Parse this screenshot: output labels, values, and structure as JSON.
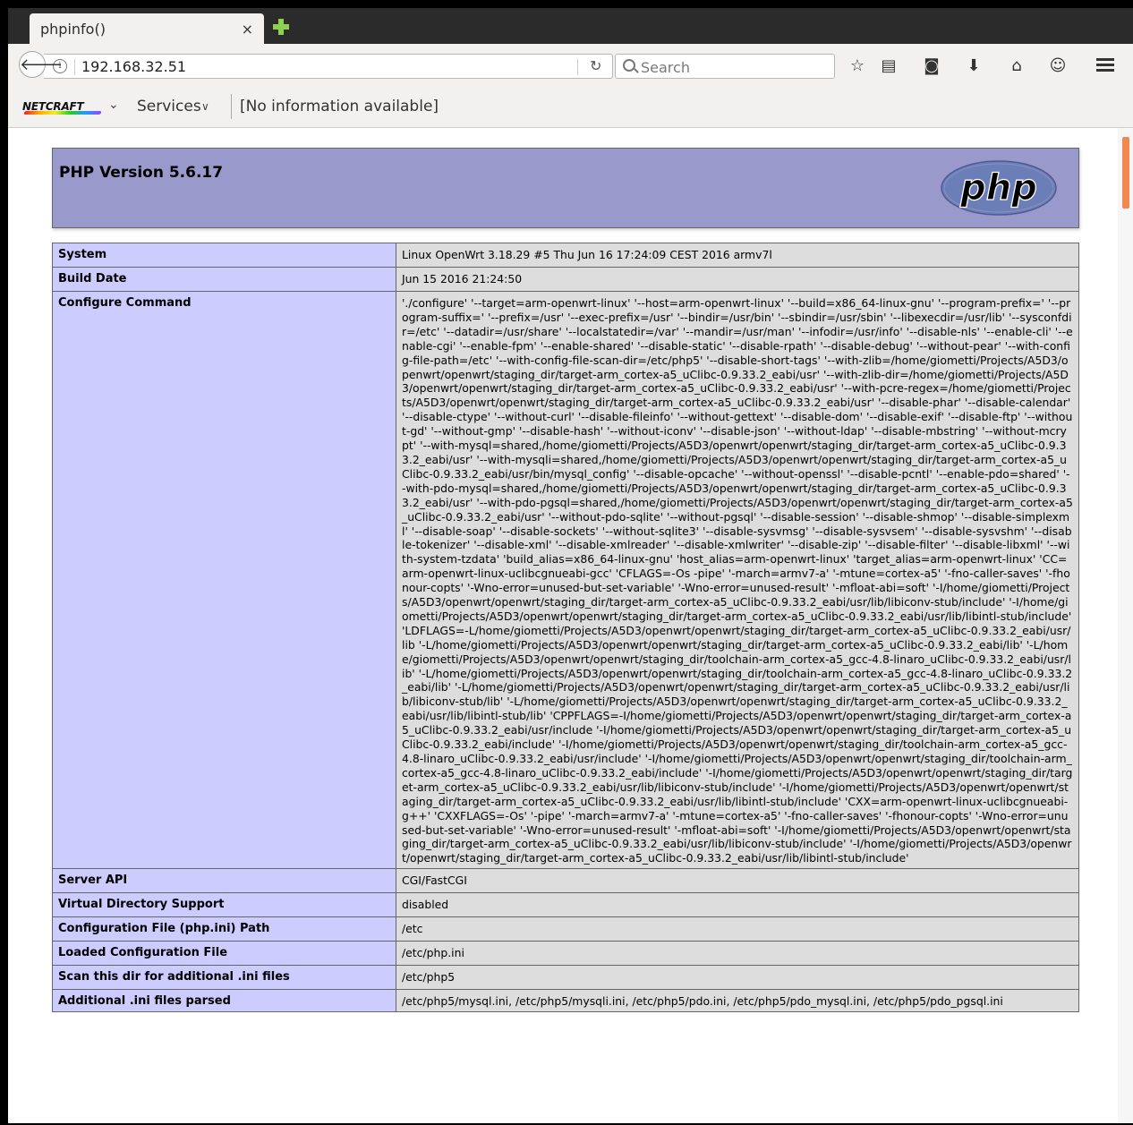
{
  "browser": {
    "tab_title": "phpinfo()",
    "tab_close": "×",
    "url": "192.168.32.51",
    "search_placeholder": "Search",
    "icons": {
      "back": "back-arrow-icon",
      "info": "info-icon",
      "reload": "reload-icon",
      "search": "search-icon",
      "bookmark": "star-icon",
      "reading_list": "clipboard-icon",
      "pocket": "pocket-icon",
      "downloads": "download-icon",
      "home": "home-icon",
      "chat": "chat-icon",
      "menu": "hamburger-menu-icon"
    }
  },
  "netcraft": {
    "logo_text": "NETCRAFT",
    "services_label": "Services",
    "info_text": "[No information available]"
  },
  "colors": {
    "header_bg": "#9999cc",
    "label_bg": "#ccccff",
    "value_bg": "#dddddd",
    "scroll_thumb": "#f0884f"
  },
  "php": {
    "version_title": "PHP Version 5.6.17",
    "logo_text": "php"
  },
  "info_rows": [
    {
      "label": "System",
      "value": "Linux OpenWrt 3.18.29 #5 Thu Jun 16 17:24:09 CEST 2016 armv7l"
    },
    {
      "label": "Build Date",
      "value": "Jun 15 2016 21:24:50"
    },
    {
      "label": "Configure Command",
      "value": "'./configure' '--target=arm-openwrt-linux' '--host=arm-openwrt-linux' '--build=x86_64-linux-gnu' '--program-prefix=' '--program-suffix=' '--prefix=/usr' '--exec-prefix=/usr' '--bindir=/usr/bin' '--sbindir=/usr/sbin' '--libexecdir=/usr/lib' '--sysconfdir=/etc' '--datadir=/usr/share' '--localstatedir=/var' '--mandir=/usr/man' '--infodir=/usr/info' '--disable-nls' '--enable-cli' '--enable-cgi' '--enable-fpm' '--enable-shared' '--disable-static' '--disable-rpath' '--disable-debug' '--without-pear' '--with-config-file-path=/etc' '--with-config-file-scan-dir=/etc/php5' '--disable-short-tags' '--with-zlib=/home/giometti/Projects/A5D3/openwrt/openwrt/staging_dir/target-arm_cortex-a5_uClibc-0.9.33.2_eabi/usr' '--with-zlib-dir=/home/giometti/Projects/A5D3/openwrt/openwrt/staging_dir/target-arm_cortex-a5_uClibc-0.9.33.2_eabi/usr' '--with-pcre-regex=/home/giometti/Projects/A5D3/openwrt/openwrt/staging_dir/target-arm_cortex-a5_uClibc-0.9.33.2_eabi/usr' '--disable-phar' '--disable-calendar' '--disable-ctype' '--without-curl' '--disable-fileinfo' '--without-gettext' '--disable-dom' '--disable-exif' '--disable-ftp' '--without-gd' '--without-gmp' '--disable-hash' '--without-iconv' '--disable-json' '--without-ldap' '--disable-mbstring' '--without-mcrypt' '--with-mysql=shared,/home/giometti/Projects/A5D3/openwrt/openwrt/staging_dir/target-arm_cortex-a5_uClibc-0.9.33.2_eabi/usr' '--with-mysqli=shared,/home/giometti/Projects/A5D3/openwrt/openwrt/staging_dir/target-arm_cortex-a5_uClibc-0.9.33.2_eabi/usr/bin/mysql_config' '--disable-opcache' '--without-openssl' '--disable-pcntl' '--enable-pdo=shared' '--with-pdo-mysql=shared,/home/giometti/Projects/A5D3/openwrt/openwrt/staging_dir/target-arm_cortex-a5_uClibc-0.9.33.2_eabi/usr' '--with-pdo-pgsql=shared,/home/giometti/Projects/A5D3/openwrt/openwrt/staging_dir/target-arm_cortex-a5_uClibc-0.9.33.2_eabi/usr' '--without-pdo-sqlite' '--without-pgsql' '--disable-session' '--disable-shmop' '--disable-simplexml' '--disable-soap' '--disable-sockets' '--without-sqlite3' '--disable-sysvmsg' '--disable-sysvsem' '--disable-sysvshm' '--disable-tokenizer' '--disable-xml' '--disable-xmlreader' '--disable-xmlwriter' '--disable-zip' '--disable-filter' '--disable-libxml' '--with-system-tzdata' 'build_alias=x86_64-linux-gnu' 'host_alias=arm-openwrt-linux' 'target_alias=arm-openwrt-linux' 'CC=arm-openwrt-linux-uclibcgnueabi-gcc' 'CFLAGS=-Os -pipe' '-march=armv7-a' '-mtune=cortex-a5' '-fno-caller-saves' '-fhonour-copts' '-Wno-error=unused-but-set-variable' '-Wno-error=unused-result' '-mfloat-abi=soft' '-I/home/giometti/Projects/A5D3/openwrt/openwrt/staging_dir/target-arm_cortex-a5_uClibc-0.9.33.2_eabi/usr/lib/libiconv-stub/include' '-I/home/giometti/Projects/A5D3/openwrt/openwrt/staging_dir/target-arm_cortex-a5_uClibc-0.9.33.2_eabi/usr/lib/libintl-stub/include' 'LDFLAGS=-L/home/giometti/Projects/A5D3/openwrt/openwrt/staging_dir/target-arm_cortex-a5_uClibc-0.9.33.2_eabi/usr/lib '-L/home/giometti/Projects/A5D3/openwrt/openwrt/staging_dir/target-arm_cortex-a5_uClibc-0.9.33.2_eabi/lib' '-L/home/giometti/Projects/A5D3/openwrt/openwrt/staging_dir/toolchain-arm_cortex-a5_gcc-4.8-linaro_uClibc-0.9.33.2_eabi/usr/lib' '-L/home/giometti/Projects/A5D3/openwrt/openwrt/staging_dir/toolchain-arm_cortex-a5_gcc-4.8-linaro_uClibc-0.9.33.2_eabi/lib' '-L/home/giometti/Projects/A5D3/openwrt/openwrt/staging_dir/target-arm_cortex-a5_uClibc-0.9.33.2_eabi/usr/lib/libiconv-stub/lib' '-L/home/giometti/Projects/A5D3/openwrt/openwrt/staging_dir/target-arm_cortex-a5_uClibc-0.9.33.2_eabi/usr/lib/libintl-stub/lib' 'CPPFLAGS=-I/home/giometti/Projects/A5D3/openwrt/openwrt/staging_dir/target-arm_cortex-a5_uClibc-0.9.33.2_eabi/usr/include '-I/home/giometti/Projects/A5D3/openwrt/openwrt/staging_dir/target-arm_cortex-a5_uClibc-0.9.33.2_eabi/include' '-I/home/giometti/Projects/A5D3/openwrt/openwrt/staging_dir/toolchain-arm_cortex-a5_gcc-4.8-linaro_uClibc-0.9.33.2_eabi/usr/include' '-I/home/giometti/Projects/A5D3/openwrt/openwrt/staging_dir/toolchain-arm_cortex-a5_gcc-4.8-linaro_uClibc-0.9.33.2_eabi/include' '-I/home/giometti/Projects/A5D3/openwrt/openwrt/staging_dir/target-arm_cortex-a5_uClibc-0.9.33.2_eabi/usr/lib/libiconv-stub/include' '-I/home/giometti/Projects/A5D3/openwrt/openwrt/staging_dir/target-arm_cortex-a5_uClibc-0.9.33.2_eabi/usr/lib/libintl-stub/include' 'CXX=arm-openwrt-linux-uclibcgnueabi-g++' 'CXXFLAGS=-Os' '-pipe' '-march=armv7-a' '-mtune=cortex-a5' '-fno-caller-saves' '-fhonour-copts' '-Wno-error=unused-but-set-variable' '-Wno-error=unused-result' '-mfloat-abi=soft' '-I/home/giometti/Projects/A5D3/openwrt/openwrt/staging_dir/target-arm_cortex-a5_uClibc-0.9.33.2_eabi/usr/lib/libiconv-stub/include' '-I/home/giometti/Projects/A5D3/openwrt/openwrt/staging_dir/target-arm_cortex-a5_uClibc-0.9.33.2_eabi/usr/lib/libintl-stub/include'"
    },
    {
      "label": "Server API",
      "value": "CGI/FastCGI"
    },
    {
      "label": "Virtual Directory Support",
      "value": "disabled"
    },
    {
      "label": "Configuration File (php.ini) Path",
      "value": "/etc"
    },
    {
      "label": "Loaded Configuration File",
      "value": "/etc/php.ini"
    },
    {
      "label": "Scan this dir for additional .ini files",
      "value": "/etc/php5"
    },
    {
      "label": "Additional .ini files parsed",
      "value": "/etc/php5/mysql.ini, /etc/php5/mysqli.ini, /etc/php5/pdo.ini, /etc/php5/pdo_mysql.ini, /etc/php5/pdo_pgsql.ini"
    }
  ]
}
